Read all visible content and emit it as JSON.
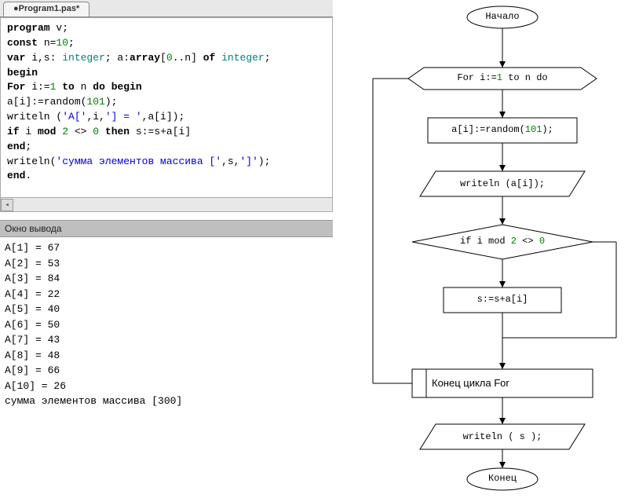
{
  "tab": {
    "title": "●Program1.pas*"
  },
  "code": {
    "l1_kw1": "program",
    "l1_id": " v;",
    "l2_kw1": "const",
    "l2_rest": " n=",
    "l2_num": "10",
    "l2_end": ";",
    "l3_kw1": "var",
    "l3_a": " i,s: ",
    "l3_t1": "integer",
    "l3_b": "; a:",
    "l3_kw2": "array",
    "l3_c": "[",
    "l3_n0": "0",
    "l3_d": "..n] ",
    "l3_kw3": "of",
    "l3_e": " ",
    "l3_t2": "integer",
    "l3_f": ";",
    "l4_kw1": "begin",
    "l5_kw1": "For",
    "l5_a": " i:=",
    "l5_n1": "1",
    "l5_b": " ",
    "l5_kw2": "to",
    "l5_c": " n ",
    "l5_kw3": "do",
    "l5_d": " ",
    "l5_kw4": "begin",
    "l6_a": "a[i]:=random(",
    "l6_n": "101",
    "l6_b": ");",
    "l7_a": "writeln (",
    "l7_s1": "'A['",
    "l7_b": ",i,",
    "l7_s2": "'] = '",
    "l7_c": ",a[i]);",
    "l8_kw1": "if",
    "l8_a": " i ",
    "l8_kw2": "mod",
    "l8_b": " ",
    "l8_n2": "2",
    "l8_c": " <> ",
    "l8_n0": "0",
    "l8_d": " ",
    "l8_kw3": "then",
    "l8_e": " s:=s+a[i]",
    "l9_kw1": "end",
    "l9_a": ";",
    "l10_a": "writeln(",
    "l10_s1": "'сумма элементов массива ['",
    "l10_b": ",s,",
    "l10_s2": "']'",
    "l10_c": ");",
    "l11_kw1": "end",
    "l11_a": "."
  },
  "output": {
    "header": "Окно вывода",
    "lines": [
      "A[1] = 67",
      "A[2] = 53",
      "A[3] = 84",
      "A[4] = 22",
      "A[5] = 40",
      "A[6] = 50",
      "A[7] = 43",
      "A[8] = 48",
      "A[9] = 66",
      "A[10] = 26",
      "сумма элементов массива [300]"
    ]
  },
  "flowchart": {
    "start": "Начало",
    "for_a": "For i:=",
    "for_n1": "1",
    "for_b": " to n do",
    "assign_a": "a[i]:=random(",
    "assign_n": "101",
    "assign_b": ");",
    "write1": "writeln (a[i]);",
    "cond_a": "if i mod ",
    "cond_n2": "2",
    "cond_b": " <> ",
    "cond_n0": "0",
    "sum": "s:=s+a[i]",
    "endfor": "Конец цикла For",
    "write2": "writeln ( s );",
    "end": "Конец"
  }
}
